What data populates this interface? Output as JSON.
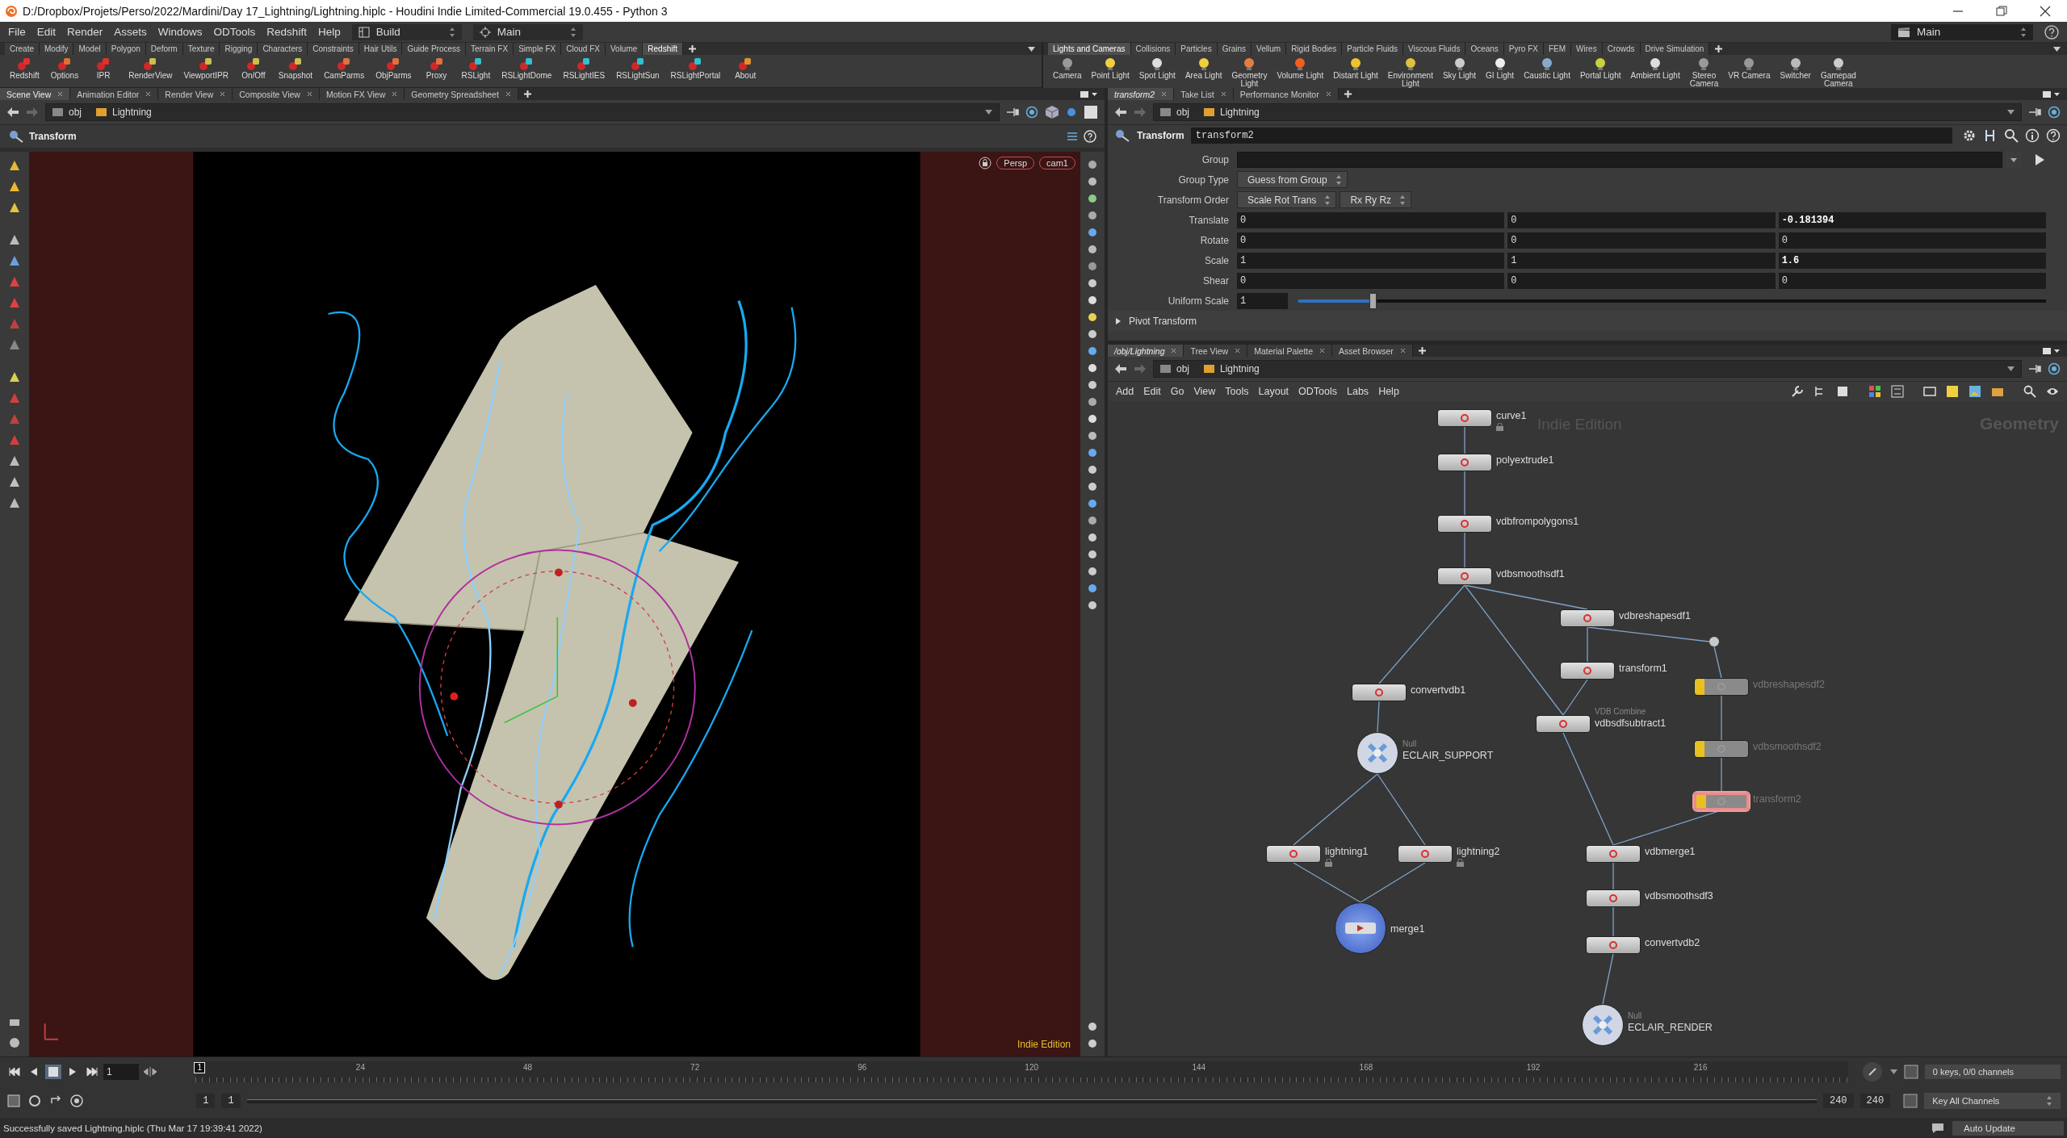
{
  "window": {
    "title": "D:/Dropbox/Projets/Perso/2022/Mardini/Day 17_Lightning/Lightning.hiplc - Houdini Indie Limited-Commercial 19.0.455 - Python 3"
  },
  "menu": [
    "File",
    "Edit",
    "Render",
    "Assets",
    "Windows",
    "ODTools",
    "Redshift",
    "Help"
  ],
  "desktop_menu": {
    "label": "Build"
  },
  "view_menu": {
    "label": "Main"
  },
  "right_desktop_menu": {
    "label": "Main"
  },
  "left_shelf": {
    "tabs": [
      {
        "label": "Create",
        "selected": false
      },
      {
        "label": "Modify",
        "selected": false
      },
      {
        "label": "Model",
        "selected": false
      },
      {
        "label": "Polygon",
        "selected": false
      },
      {
        "label": "Deform",
        "selected": false
      },
      {
        "label": "Texture",
        "selected": false
      },
      {
        "label": "Rigging",
        "selected": false
      },
      {
        "label": "Characters",
        "selected": false
      },
      {
        "label": "Constraints",
        "selected": false
      },
      {
        "label": "Hair Utils",
        "selected": false
      },
      {
        "label": "Guide Process",
        "selected": false
      },
      {
        "label": "Terrain FX",
        "selected": false
      },
      {
        "label": "Simple FX",
        "selected": false
      },
      {
        "label": "Cloud FX",
        "selected": false
      },
      {
        "label": "Volume",
        "selected": false
      },
      {
        "label": "Redshift",
        "selected": true
      }
    ],
    "tools": [
      "Redshift",
      "Options",
      "IPR",
      "RenderView",
      "ViewportIPR",
      "On/Off",
      "Snapshot",
      "CamParms",
      "ObjParms",
      "Proxy",
      "RSLight",
      "RSLightDome",
      "RSLightIES",
      "RSLightSun",
      "RSLightPortal",
      "About"
    ]
  },
  "right_shelf": {
    "tabs": [
      {
        "label": "Lights and Cameras",
        "selected": true
      },
      {
        "label": "Collisions",
        "selected": false
      },
      {
        "label": "Particles",
        "selected": false
      },
      {
        "label": "Grains",
        "selected": false
      },
      {
        "label": "Vellum",
        "selected": false
      },
      {
        "label": "Rigid Bodies",
        "selected": false
      },
      {
        "label": "Particle Fluids",
        "selected": false
      },
      {
        "label": "Viscous Fluids",
        "selected": false
      },
      {
        "label": "Oceans",
        "selected": false
      },
      {
        "label": "Pyro FX",
        "selected": false
      },
      {
        "label": "FEM",
        "selected": false
      },
      {
        "label": "Wires",
        "selected": false
      },
      {
        "label": "Crowds",
        "selected": false
      },
      {
        "label": "Drive Simulation",
        "selected": false
      }
    ],
    "tools": [
      "Camera",
      "Point Light",
      "Spot Light",
      "Area Light",
      "Geometry\nLight",
      "Volume Light",
      "Distant Light",
      "Environment\nLight",
      "Sky Light",
      "GI Light",
      "Caustic Light",
      "Portal Light",
      "Ambient Light",
      "Stereo\nCamera",
      "VR Camera",
      "Switcher",
      "Gamepad\nCamera"
    ]
  },
  "scene_view": {
    "tabs": [
      {
        "label": "Scene View",
        "selected": true
      },
      {
        "label": "Animation Editor",
        "selected": false
      },
      {
        "label": "Render View",
        "selected": false
      },
      {
        "label": "Composite View",
        "selected": false
      },
      {
        "label": "Motion FX View",
        "selected": false
      },
      {
        "label": "Geometry Spreadsheet",
        "selected": false
      }
    ],
    "path": [
      "obj",
      "Lightning"
    ],
    "operation": "Transform",
    "view_menu": "Persp",
    "camera_menu": "cam1",
    "edition_label": "Indie Edition"
  },
  "parameters": {
    "tabs": [
      {
        "label": "transform2",
        "selected": true
      },
      {
        "label": "Take List",
        "selected": false
      },
      {
        "label": "Performance Monitor",
        "selected": false
      }
    ],
    "path": [
      "obj",
      "Lightning"
    ],
    "node_type": "Transform",
    "node_name": "transform2",
    "rows": [
      {
        "kind": "field",
        "label": "Group"
      },
      {
        "kind": "menu",
        "label": "Group Type",
        "menus": [
          "Guess from Group"
        ]
      },
      {
        "kind": "menu",
        "label": "Transform Order",
        "menus": [
          "Scale Rot Trans",
          "Rx Ry Rz"
        ]
      },
      {
        "kind": "vector",
        "label": "Translate",
        "values": [
          {
            "text": "0",
            "changed": false
          },
          {
            "text": "0",
            "changed": false
          },
          {
            "text": "-0.181394",
            "changed": true
          }
        ]
      },
      {
        "kind": "vector",
        "label": "Rotate",
        "values": [
          {
            "text": "0",
            "changed": false
          },
          {
            "text": "0",
            "changed": false
          },
          {
            "text": "0",
            "changed": false
          }
        ]
      },
      {
        "kind": "vector",
        "label": "Scale",
        "values": [
          {
            "text": "1",
            "changed": false
          },
          {
            "text": "1",
            "changed": false
          },
          {
            "text": "1.6",
            "changed": true
          }
        ]
      },
      {
        "kind": "vector",
        "label": "Shear",
        "values": [
          {
            "text": "0",
            "changed": false
          },
          {
            "text": "0",
            "changed": false
          },
          {
            "text": "0",
            "changed": false
          }
        ]
      },
      {
        "kind": "slider",
        "label": "Uniform Scale",
        "value": "1",
        "level": 0.1
      }
    ],
    "folder": {
      "label": "Pivot Transform",
      "expanded": false
    }
  },
  "network": {
    "tabs": [
      {
        "label": "/obj/Lightning",
        "selected": true
      },
      {
        "label": "Tree View",
        "selected": false
      },
      {
        "label": "Material Palette",
        "selected": false
      },
      {
        "label": "Asset Browser",
        "selected": false
      }
    ],
    "path": [
      "obj",
      "Lightning"
    ],
    "menu": [
      "Add",
      "Edit",
      "Go",
      "View",
      "Tools",
      "Layout",
      "ODTools",
      "Labs",
      "Help"
    ],
    "watermark": "Indie Edition",
    "context": "Geometry",
    "nodes": [
      {
        "name": "curve1",
        "kind": "box",
        "bypassed": false,
        "selected": false,
        "locked": true
      },
      {
        "name": "polyextrude1",
        "kind": "box",
        "bypassed": false,
        "selected": false,
        "locked": false
      },
      {
        "name": "vdbfrompolygons1",
        "kind": "box",
        "bypassed": false,
        "selected": false,
        "locked": false
      },
      {
        "name": "vdbsmoothsdf1",
        "kind": "box",
        "bypassed": false,
        "selected": false,
        "locked": false
      },
      {
        "name": "vdbreshapesdf1",
        "kind": "box",
        "bypassed": false,
        "selected": false,
        "locked": false
      },
      {
        "name": "transform1",
        "kind": "box",
        "bypassed": false,
        "selected": false,
        "locked": false
      },
      {
        "name": "vdbreshapesdf2",
        "kind": "box",
        "bypassed": true,
        "selected": false,
        "locked": false
      },
      {
        "name": "convertvdb1",
        "kind": "box",
        "bypassed": false,
        "selected": false,
        "locked": false
      },
      {
        "name": "vdbsdfsubtract1",
        "type_label": "VDB Combine",
        "kind": "box",
        "bypassed": false,
        "selected": false,
        "locked": false
      },
      {
        "name": "ECLAIR_SUPPORT",
        "type_label": "Null",
        "kind": "null",
        "bypassed": false,
        "selected": false
      },
      {
        "name": "vdbsmoothsdf2",
        "kind": "box",
        "bypassed": true,
        "selected": false,
        "locked": false
      },
      {
        "name": "transform2",
        "kind": "box",
        "bypassed": true,
        "selected": true,
        "locked": false
      },
      {
        "name": "lightning1",
        "kind": "box",
        "bypassed": false,
        "selected": false,
        "locked": true
      },
      {
        "name": "lightning2",
        "kind": "box",
        "bypassed": false,
        "selected": false,
        "locked": true
      },
      {
        "name": "vdbmerge1",
        "kind": "box",
        "bypassed": false,
        "selected": false,
        "locked": false
      },
      {
        "name": "merge1",
        "kind": "merge",
        "bypassed": false,
        "selected": false
      },
      {
        "name": "vdbsmoothsdf3",
        "kind": "box",
        "bypassed": false,
        "selected": false,
        "locked": false
      },
      {
        "name": "convertvdb2",
        "kind": "box",
        "bypassed": false,
        "selected": false,
        "locked": false
      },
      {
        "name": "ECLAIR_RENDER",
        "type_label": "Null",
        "kind": "null",
        "bypassed": false,
        "selected": false
      }
    ]
  },
  "timeline": {
    "frame": "1",
    "marker": "1",
    "ticks": [
      "24",
      "48",
      "72",
      "96",
      "120",
      "144",
      "168",
      "192",
      "216"
    ],
    "range_start": "1",
    "range_current": "1",
    "range_end": "240",
    "range_limit": "240",
    "keys_info": "0 keys, 0/0 channels",
    "key_button": "Key All Channels"
  },
  "status": {
    "message": "Successfully saved Lightning.hiplc (Thu Mar 17 19:39:41 2022)",
    "update_mode": "Auto Update"
  }
}
